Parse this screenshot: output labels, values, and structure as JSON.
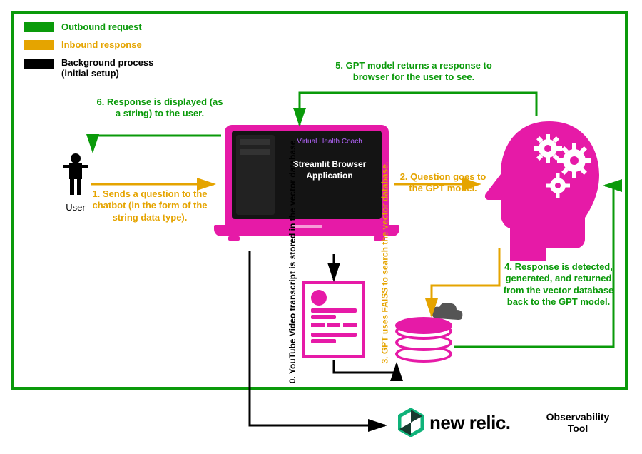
{
  "legend": {
    "outbound": "Outbound request",
    "inbound": "Inbound response",
    "background_l1": "Background process",
    "background_l2": "(initial setup)"
  },
  "colors": {
    "green": "#0a9a0a",
    "yellow": "#e5a400",
    "black": "#000000",
    "magenta": "#e61aa7"
  },
  "user_label": "User",
  "laptop": {
    "window_title": "Virtual Health Coach",
    "app_name": "Streamlit Browser\nApplication"
  },
  "steps": {
    "s0": "0. YouTube Video transcript is stored in the vector database",
    "s1": "1. Sends a question to the chatbot (in the form of the string data type).",
    "s2": "2. Question goes to the GPT model.",
    "s3": "3. GPT uses FAISS to search the vector database.",
    "s4": "4. Response is detected, generated, and returned from the vector database back to the GPT model.",
    "s5": "5. GPT model returns a response to browser for the user to see.",
    "s6": "6. Response is displayed (as a string) to the user."
  },
  "brand": {
    "name": "new relic",
    "dot": ".",
    "tagline": "Observability Tool"
  }
}
